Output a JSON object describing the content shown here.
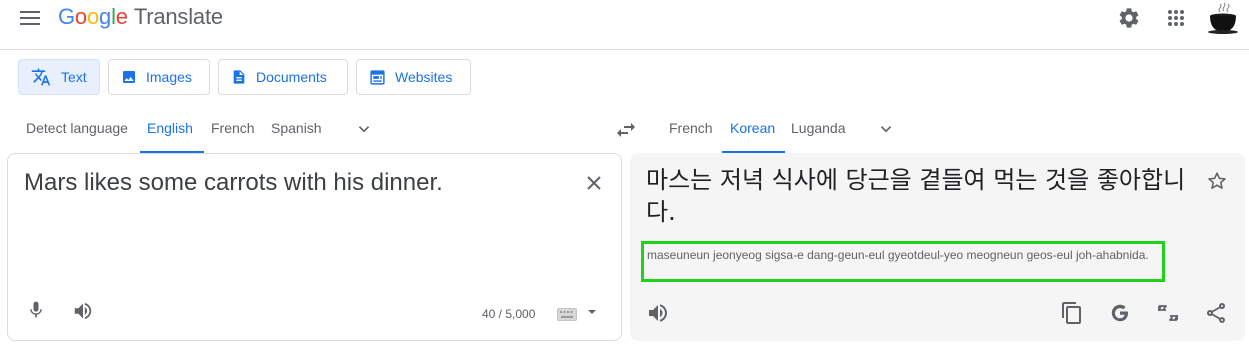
{
  "header": {
    "logo_letters": [
      "G",
      "o",
      "o",
      "g",
      "l",
      "e"
    ],
    "product": "Translate"
  },
  "modes": [
    {
      "label": "Text",
      "icon": "translate-icon",
      "active": true
    },
    {
      "label": "Images",
      "icon": "image-icon",
      "active": false
    },
    {
      "label": "Documents",
      "icon": "document-icon",
      "active": false
    },
    {
      "label": "Websites",
      "icon": "website-icon",
      "active": false
    }
  ],
  "source_languages": [
    "Detect language",
    "English",
    "French",
    "Spanish"
  ],
  "source_selected": "English",
  "target_languages": [
    "French",
    "Korean",
    "Luganda"
  ],
  "target_selected": "Korean",
  "source": {
    "text": "Mars likes some carrots with his dinner.",
    "char_count": "40 / 5,000"
  },
  "target": {
    "text": "마스는 저녁 식사에 당근을 곁들여 먹는 것을 좋아합니다.",
    "romanization": "maseuneun jeonyeog sigsa-e dang-geun-eul gyeotdeul-yeo meogneun geos-eul joh-ahabnida."
  },
  "colors": {
    "accent": "#1a73e8",
    "highlight_box": "#1fd21a",
    "target_bg": "#f5f5f5"
  }
}
